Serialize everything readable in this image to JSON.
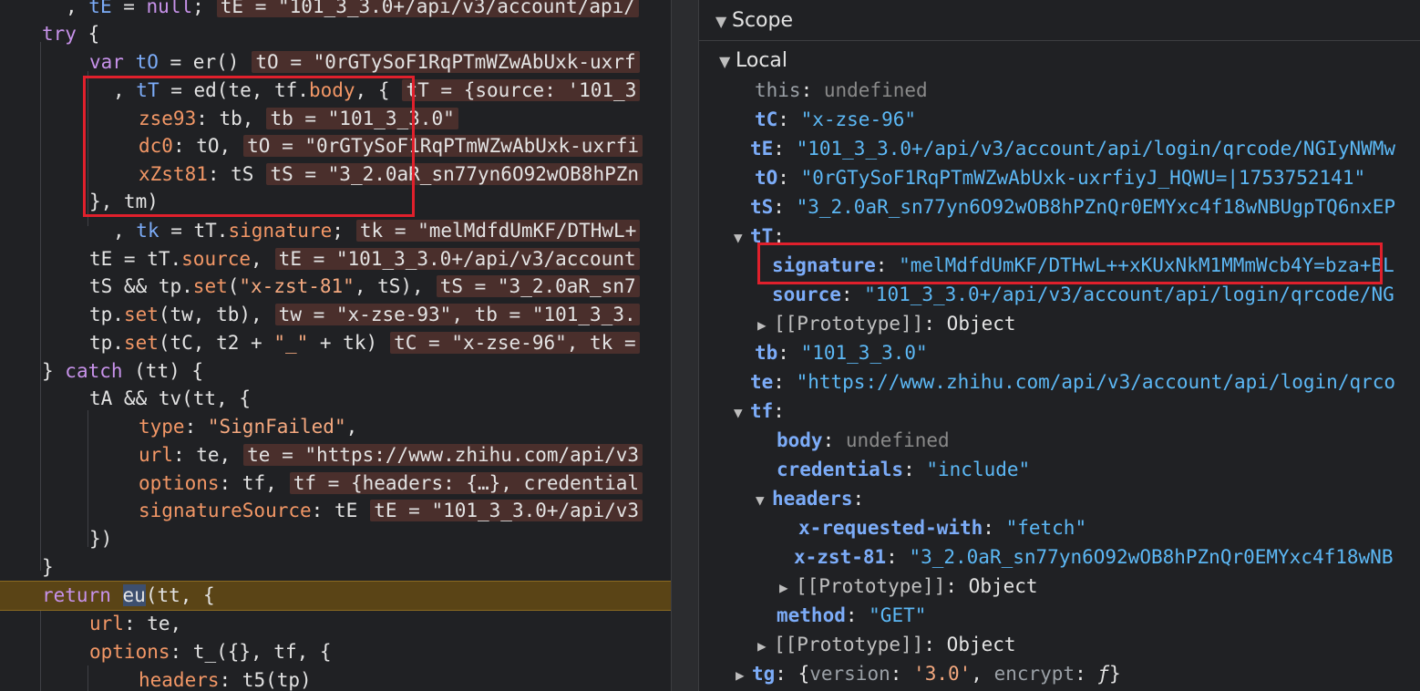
{
  "code_lines": [
    ", tE = null;",
    "try {",
    "var tO = er()",
    ", tT = ed(te, tf.body, {",
    "zse93: tb,",
    "dc0: tO,",
    "xZst81: tS",
    "}, tm)",
    ", tk = tT.signature;",
    "tE = tT.source,",
    "tS && tp.set(\"x-zst-81\", tS),",
    "tp.set(tw, tb),",
    "tp.set(tC, t2 + \"_\" + tk)",
    "} catch (tt) {",
    "tA && tv(tt, {",
    "type: \"SignFailed\",",
    "url: te,",
    "options: tf,",
    "signatureSource: tE",
    "})",
    "}",
    "return eu(tt, {",
    "url: te,",
    "options: t_({}, tf, {",
    "headers: t5(tp)"
  ],
  "annotations": {
    "a0": "tE = \"101_3_3.0+/api/v3/account/api/",
    "a2": "tO = \"0rGTySoF1RqPTmWZwAbUxk-uxrf",
    "a3": "tT = {source: '101_3",
    "a4": "tb = \"101_3_3.0\"",
    "a5": "tO = \"0rGTySoF1RqPTmWZwAbUxk-uxrfi",
    "a6": "tS = \"3_2.0aR_sn77yn6O92wOB8hPZn",
    "a8": "tk = \"melMdfdUmKF/DTHwL+",
    "a9": "tE = \"101_3_3.0+/api/v3/account",
    "a10": "tS = \"3_2.0aR_sn7",
    "a11": "tw = \"x-zse-93\", tb = \"101_3_3.",
    "a12": "tC = \"x-zse-96\", tk =",
    "a16": "te = \"https://www.zhihu.com/api/v3",
    "a17": "tf = {headers: {…}, credential",
    "a18": "tE = \"101_3_3.0+/api/v3"
  },
  "scope": {
    "title": "Scope",
    "local_label": "Local",
    "this_key": "this",
    "this_val": "undefined",
    "tC_key": "tC",
    "tC_val": "\"x-zse-96\"",
    "tE_key": "tE",
    "tE_val": "\"101_3_3.0+/api/v3/account/api/login/qrcode/NGIyNWMw",
    "tO_key": "tO",
    "tO_val": "\"0rGTySoF1RqPTmWZwAbUxk-uxrfiyJ_HQWU=|1753752141\"",
    "tS_key": "tS",
    "tS_val": "\"3_2.0aR_sn77yn6O92wOB8hPZnQr0EMYxc4f18wNBUgpTQ6nxEP",
    "tT_key": "tT",
    "signature_key": "signature",
    "signature_val": "\"melMdfdUmKF/DTHwL++xKUxNkM1MMmWcb4Y=bza+BL",
    "source_key": "source",
    "source_val": "\"101_3_3.0+/api/v3/account/api/login/qrcode/NG",
    "proto1": "[[Prototype]]",
    "object": "Object",
    "tb_key": "tb",
    "tb_val": "\"101_3_3.0\"",
    "te_key": "te",
    "te_val": "\"https://www.zhihu.com/api/v3/account/api/login/qrco",
    "tf_key": "tf",
    "body_key": "body",
    "body_val": "undefined",
    "credentials_key": "credentials",
    "credentials_val": "\"include\"",
    "headers_key": "headers",
    "xrw_key": "x-requested-with",
    "xrw_val": "\"fetch\"",
    "xzst_key": "x-zst-81",
    "xzst_val": "\"3_2.0aR_sn77yn6O92wOB8hPZnQr0EMYxc4f18wNB",
    "method_key": "method",
    "method_val": "\"GET\"",
    "tg_key": "tg",
    "tg_version_key": "version",
    "tg_version_val": "'3.0'",
    "tg_encrypt_key": "encrypt",
    "tg_encrypt_val": "ƒ"
  },
  "colors": {
    "highlight_box": "#e0202c",
    "exec_line": "#5a4416",
    "annotation_bg": "#4a2f2c"
  }
}
